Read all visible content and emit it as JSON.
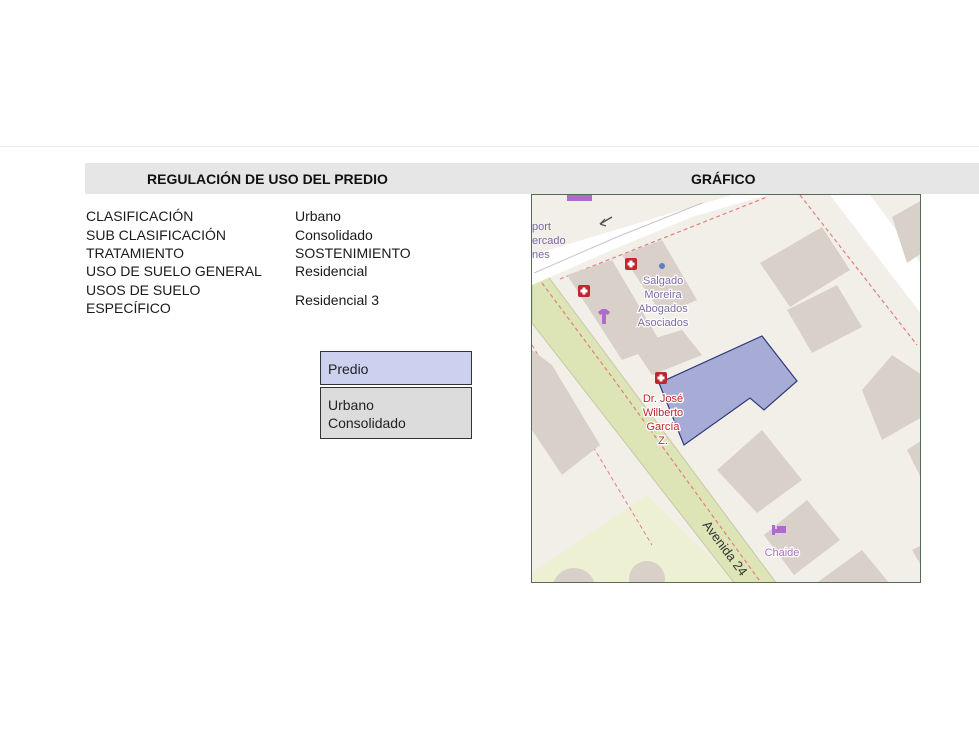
{
  "section_titles": {
    "left": "REGULACIÓN DE USO DEL PREDIO",
    "right": "GRÁFICO"
  },
  "regulation": [
    {
      "label": "CLASIFICACIÓN",
      "value": "Urbano"
    },
    {
      "label": "SUB CLASIFICACIÓN",
      "value": "Consolidado"
    },
    {
      "label": "TRATAMIENTO",
      "value": "SOSTENIMIENTO"
    },
    {
      "label": "USO DE SUELO GENERAL",
      "value": "Residencial"
    },
    {
      "label_line1": "USOS DE SUELO",
      "label_line2": "ESPECÍFICO",
      "value": "Residencial 3"
    }
  ],
  "legend": {
    "predio": "Predio",
    "zone_line1": "Urbano",
    "zone_line2": "Consolidado"
  },
  "map": {
    "street": "Avenida 24",
    "poi_left_line1": "port",
    "poi_left_line2": "ercado",
    "poi_left_line3": "nes",
    "poi_law_line1": "Salgado",
    "poi_law_line2": "Moreira",
    "poi_law_line3": "Abogados",
    "poi_law_line4": "Asociados",
    "poi_doctor_line1": "Dr. José",
    "poi_doctor_line2": "Wilberto",
    "poi_doctor_line3": "García",
    "poi_doctor_line4": "Z.",
    "poi_hotel": "Chaide",
    "colors": {
      "parcel_fill": "#a6acd6",
      "parcel_stroke": "#2e3a7a",
      "building": "#d9d0c9",
      "avenue": "#dde4b6",
      "park": "#eef0d4",
      "poi_text": "#7d6aa8",
      "poi_red": "#c0262d"
    }
  }
}
